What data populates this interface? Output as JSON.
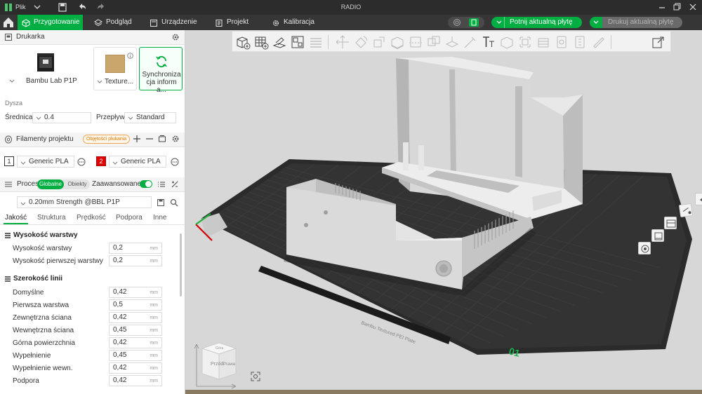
{
  "titlebar": {
    "menu_label": "Plik",
    "window_title": "RADIO"
  },
  "maintoolbar": {
    "tabs": [
      {
        "label": "Przygotowanie"
      },
      {
        "label": "Podgląd"
      },
      {
        "label": "Urządzenie"
      },
      {
        "label": "Projekt"
      },
      {
        "label": "Kalibracja"
      }
    ],
    "slice_button": "Potnij aktualną płytę",
    "print_button": "Drukuj aktualną płytę"
  },
  "printer": {
    "section_title": "Drukarka",
    "printer_name": "Bambu Lab P1P",
    "plate_name": "Texture...",
    "sync_label": "Synchronizacja informa..."
  },
  "nozzle": {
    "section_label": "Dysza",
    "diameter_label": "Średnica",
    "diameter_value": "0.4",
    "flow_label": "Przepływ",
    "flow_value": "Standard"
  },
  "filaments": {
    "section_title": "Filamenty projektu",
    "flush_badge": "Objętości płukania",
    "items": [
      {
        "index": "1",
        "name": "Generic PLA",
        "color": "#ffffff"
      },
      {
        "index": "2",
        "name": "Generic PLA",
        "color": "#e00000"
      }
    ]
  },
  "process": {
    "section_title": "Proces",
    "toggle_global": "Globalne",
    "toggle_objects": "Obiekty",
    "advanced_label": "Zaawansowane",
    "advanced_on": true,
    "preset": "0.20mm Strength @BBL P1P",
    "subtabs": [
      "Jakość",
      "Struktura",
      "Prędkość",
      "Podpora",
      "Inne"
    ],
    "groups": [
      {
        "title": "Wysokość warstwy",
        "params": [
          {
            "label": "Wysokość warstwy",
            "value": "0,2",
            "unit": "mm"
          },
          {
            "label": "Wysokość pierwszej warstwy",
            "value": "0,2",
            "unit": "mm"
          }
        ]
      },
      {
        "title": "Szerokość linii",
        "params": [
          {
            "label": "Domyślne",
            "value": "0,42",
            "unit": "mm"
          },
          {
            "label": "Pierwsza warstwa",
            "value": "0,5",
            "unit": "mm"
          },
          {
            "label": "Zewnętrzna ściana",
            "value": "0,42",
            "unit": "mm"
          },
          {
            "label": "Wewnętrzna ściana",
            "value": "0,45",
            "unit": "mm"
          },
          {
            "label": "Górna powierzchnia",
            "value": "0,42",
            "unit": "mm"
          },
          {
            "label": "Wypełnienie",
            "value": "0,45",
            "unit": "mm"
          },
          {
            "label": "Wypełnienie wewn.",
            "value": "0,42",
            "unit": "mm"
          },
          {
            "label": "Podpora",
            "value": "0,42",
            "unit": "mm"
          }
        ]
      }
    ]
  },
  "viewport": {
    "plate_number": "01",
    "plate_text": "Bambu Textured PEI Plate",
    "view_cube_front": "Przód",
    "view_cube_right": "Prawa",
    "view_cube_top": "Góra"
  },
  "colors": {
    "accent": "#00ae42",
    "titlebar": "#2c2c2c",
    "toolbar": "#363636",
    "plate": "#2b2b2b"
  }
}
